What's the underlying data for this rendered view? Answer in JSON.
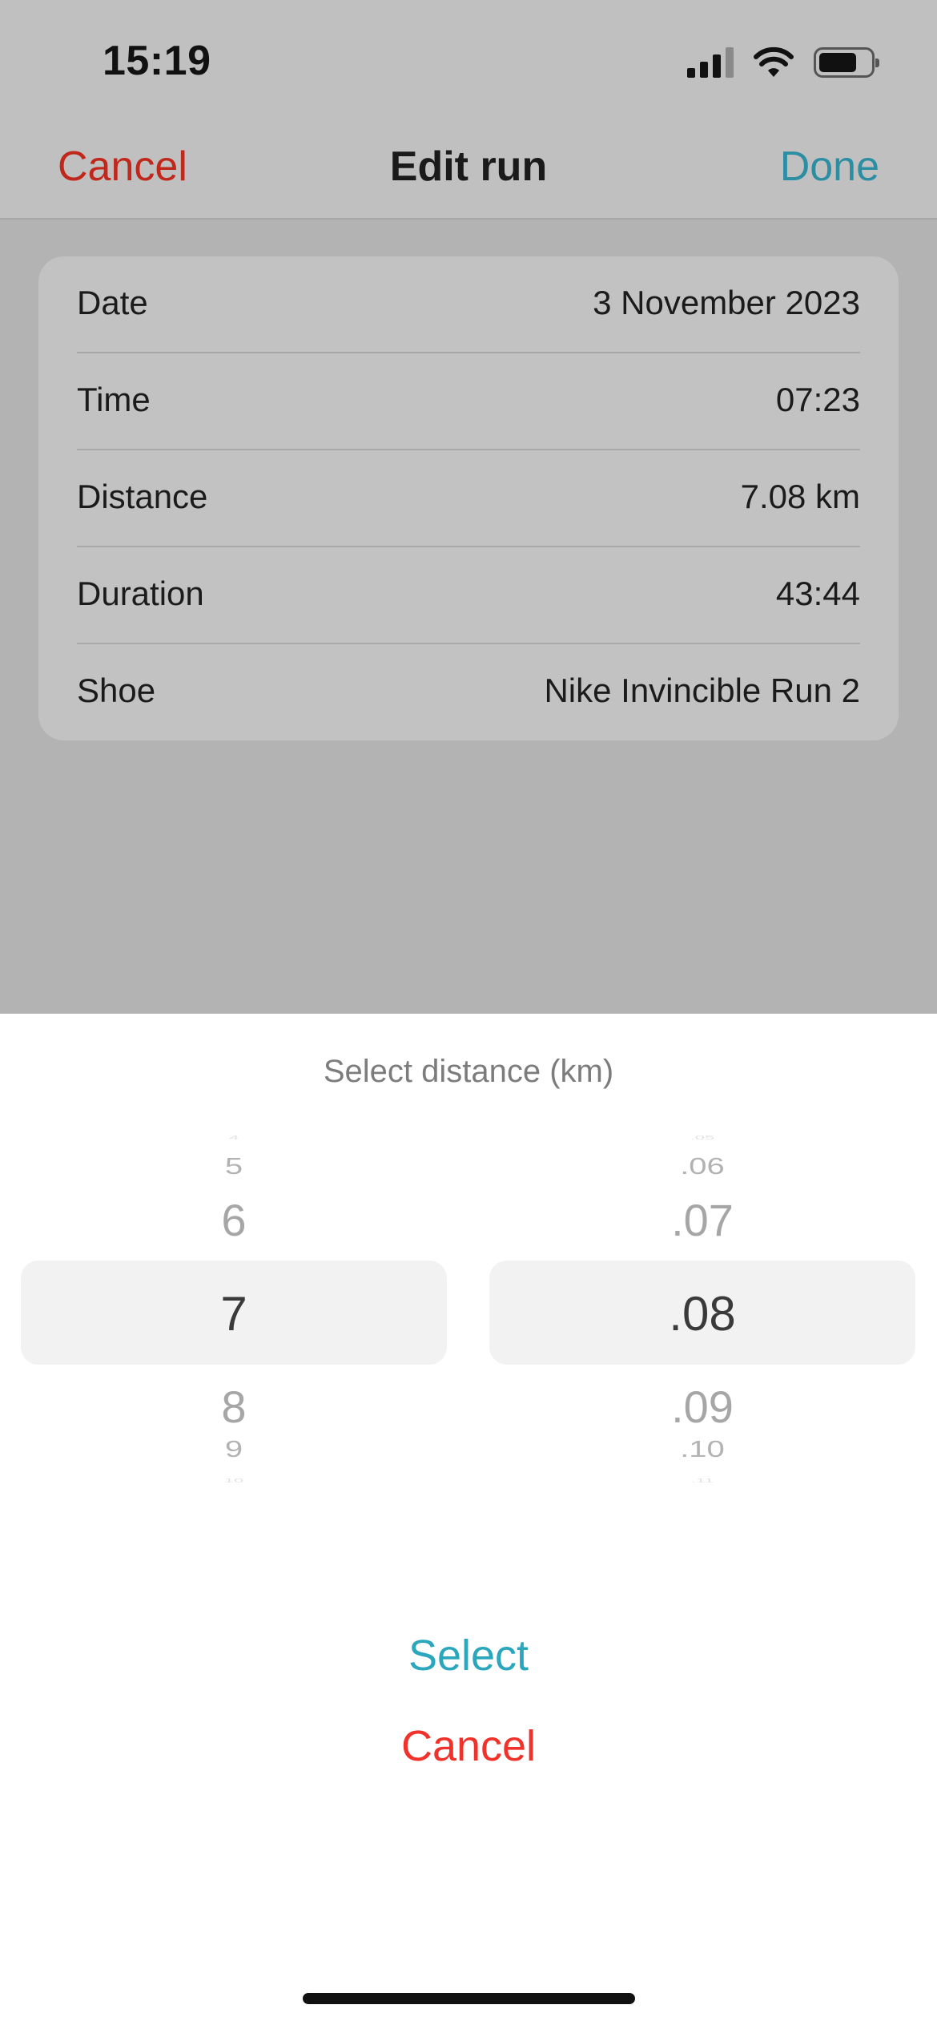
{
  "status_bar": {
    "time": "15:19",
    "icons": [
      "cellular-signal-icon",
      "wifi-icon",
      "battery-icon"
    ]
  },
  "nav": {
    "cancel_label": "Cancel",
    "title": "Edit run",
    "done_label": "Done",
    "colors": {
      "cancel": "#c0281c",
      "done": "#2c8ea3"
    }
  },
  "form": {
    "rows": [
      {
        "label": "Date",
        "value": "3 November 2023"
      },
      {
        "label": "Time",
        "value": "07:23"
      },
      {
        "label": "Distance",
        "value": "7.08 km"
      },
      {
        "label": "Duration",
        "value": "43:44"
      },
      {
        "label": "Shoe",
        "value": "Nike Invincible Run 2"
      }
    ]
  },
  "sheet": {
    "title": "Select distance (km)",
    "km_wheel": {
      "items": [
        "4",
        "5",
        "6",
        "7",
        "8",
        "9",
        "10"
      ],
      "selected": "7"
    },
    "decimal_wheel": {
      "items": [
        ".05",
        ".06",
        ".07",
        ".08",
        ".09",
        ".10",
        ".11"
      ],
      "selected": ".08"
    },
    "select_label": "Select",
    "cancel_label": "Cancel",
    "colors": {
      "select": "#2aa6bd",
      "cancel": "#f0322a"
    }
  }
}
